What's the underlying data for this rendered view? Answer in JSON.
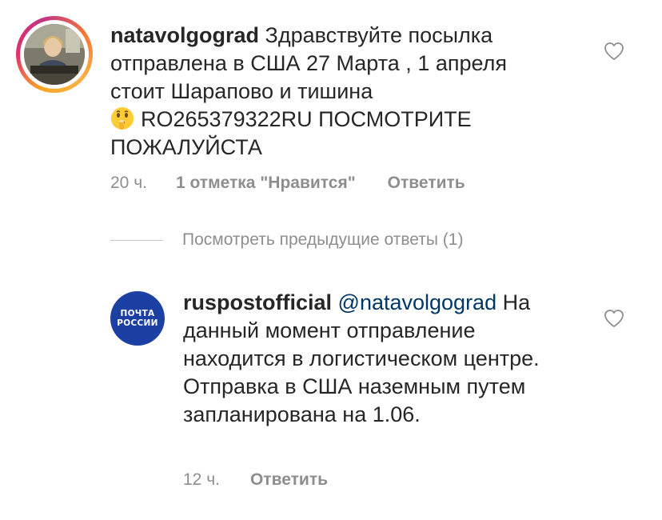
{
  "comments": [
    {
      "username": "natavolgograd",
      "text_before_emoji": "Здравствуйте посылка отправлена в США  27 Марта , 1 апреля стоит Шарапово и тишина",
      "emoji": "shushing-face-emoji",
      "text_after_emoji": "RO265379322RU ПОСМОТРИТЕ ПОЖАЛУЙСТА",
      "time": "20 ч.",
      "likes": "1 отметка \"Нравится\"",
      "reply": "Ответить",
      "avatar": "profile-photo",
      "icons": {
        "like": "heart-outline-icon"
      }
    },
    {
      "username": "ruspostofficial",
      "mention": "@natavolgograd",
      "text": "На данный момент отправление находится в логистическом центре. Отправка в США наземным путем запланирована на 1.06.",
      "time": "12 ч.",
      "reply": "Ответить",
      "avatar_logo": [
        "ПОЧТА",
        "РОССИИ"
      ],
      "icons": {
        "like": "heart-outline-icon"
      }
    }
  ],
  "view_previous_replies": "Посмотреть предыдущие ответы (1)",
  "colors": {
    "text": "#262626",
    "muted": "#8e8e8e",
    "mention": "#00376b",
    "post_blue": "#1c3fa3"
  }
}
